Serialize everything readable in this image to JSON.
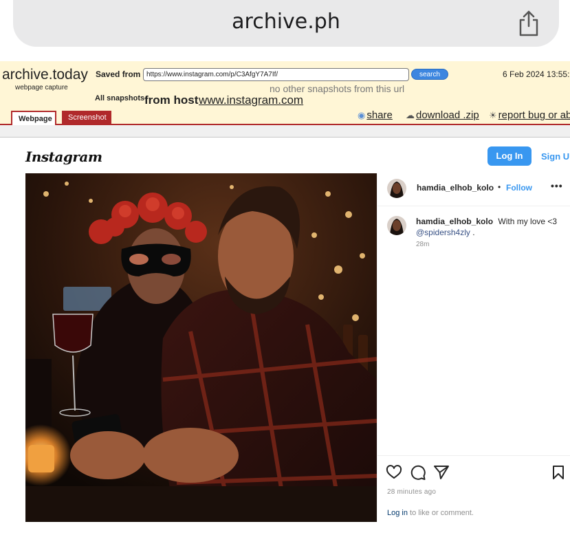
{
  "browser": {
    "url_display": "archive.ph",
    "share_icon": "share-icon"
  },
  "archive": {
    "logo": "archive.today",
    "logo_sub": "webpage capture",
    "saved_from_label": "Saved from",
    "saved_url": "https://www.instagram.com/p/C3AfgY7A7If/",
    "search_label": "search",
    "date": "6 Feb 2024 13:55:",
    "no_other": "no other snapshots from this url",
    "all_snapshots_label": "All snapshots",
    "from_host_label": "from host",
    "host_link": "www.instagram.com",
    "tabs": [
      {
        "label": "Webpage",
        "active": true
      },
      {
        "label": "Screenshot",
        "active": false
      }
    ],
    "actions": {
      "share": "share",
      "download": "download .zip",
      "report": "report bug or ab"
    },
    "accent_color": "#b0292b",
    "header_bg": "#fff6d6"
  },
  "instagram": {
    "logo": "Instagram",
    "login_label": "Log In",
    "signup_label": "Sign Up",
    "post": {
      "username": "hamdia_elhob_kolo",
      "separator": "•",
      "follow_label": "Follow",
      "more_label": "•••",
      "caption_user": "hamdia_elhob_kolo",
      "caption_text": "With my love <3",
      "caption_mention": "@spidersh4zly",
      "caption_end": ".",
      "caption_time": "28m",
      "time_ago": "28 minutes ago",
      "login_link": "Log in",
      "login_rest": "to like or comment."
    },
    "icons": [
      "heart-icon",
      "comment-icon",
      "send-icon",
      "bookmark-icon"
    ],
    "brand_blue": "#3897f0"
  }
}
